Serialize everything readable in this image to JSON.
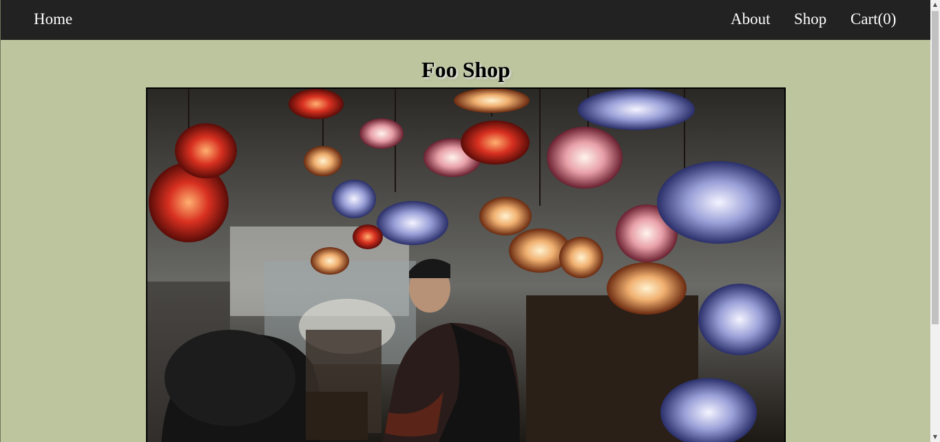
{
  "nav": {
    "home": "Home",
    "about": "About",
    "shop": "Shop",
    "cart": "Cart(0)"
  },
  "main": {
    "title": "Foo Shop"
  },
  "hero": {
    "alt": "Market stall with hanging mosaic lanterns"
  },
  "colors": {
    "navbar": "#222222",
    "background": "#bdc59f",
    "nav_text": "#ffffff"
  }
}
